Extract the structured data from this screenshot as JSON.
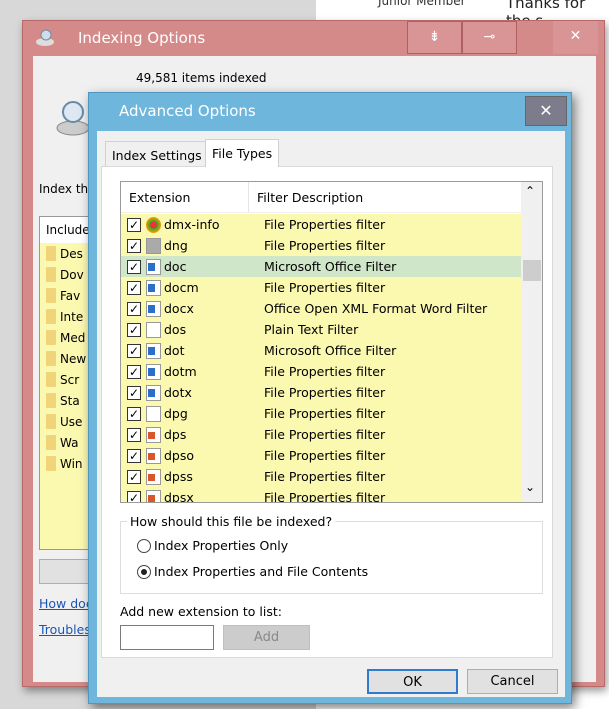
{
  "background_page": {
    "text_1": "Junior Member",
    "text_2": "Thanks for the s"
  },
  "indexing_window": {
    "title": "Indexing Options",
    "items_indexed": "49,581 items indexed",
    "index_label": "Index the",
    "included_header": "Include",
    "included_items": [
      {
        "label": "Des",
        "icon": "desktop-folder-icon"
      },
      {
        "label": "Dov",
        "icon": "download-icon"
      },
      {
        "label": "Fav",
        "icon": "favorites-folder-icon"
      },
      {
        "label": "Inte",
        "icon": "internet-explorer-icon"
      },
      {
        "label": "Med",
        "icon": "drive-icon"
      },
      {
        "label": "New",
        "icon": "folder-icon"
      },
      {
        "label": "Scr",
        "icon": "folder-icon"
      },
      {
        "label": "Sta",
        "icon": "folder-icon"
      },
      {
        "label": "Use",
        "icon": "folder-icon"
      },
      {
        "label": "Wa",
        "icon": "folder-icon"
      },
      {
        "label": "Win",
        "icon": "folder-icon"
      }
    ],
    "link_1": "How doe",
    "link_2": "Troubles"
  },
  "advanced_dialog": {
    "title": "Advanced Options",
    "close": "✕",
    "tabs": [
      {
        "label": "Index Settings",
        "active": false
      },
      {
        "label": "File Types",
        "active": true
      }
    ],
    "columns": {
      "extension": "Extension",
      "description": "Filter Description"
    },
    "rows": [
      {
        "ext": "dmx-info",
        "desc": "File Properties filter",
        "icon": "gear",
        "checked": true
      },
      {
        "ext": "dng",
        "desc": "File Properties filter",
        "icon": "img",
        "checked": true
      },
      {
        "ext": "doc",
        "desc": "Microsoft Office Filter",
        "icon": "word",
        "checked": true,
        "selected": true
      },
      {
        "ext": "docm",
        "desc": "File Properties filter",
        "icon": "word",
        "checked": true
      },
      {
        "ext": "docx",
        "desc": "Office Open XML Format Word Filter",
        "icon": "word",
        "checked": true
      },
      {
        "ext": "dos",
        "desc": "Plain Text Filter",
        "icon": "plain",
        "checked": true
      },
      {
        "ext": "dot",
        "desc": "Microsoft Office Filter",
        "icon": "word",
        "checked": true
      },
      {
        "ext": "dotm",
        "desc": "File Properties filter",
        "icon": "word",
        "checked": true
      },
      {
        "ext": "dotx",
        "desc": "File Properties filter",
        "icon": "word",
        "checked": true
      },
      {
        "ext": "dpg",
        "desc": "File Properties filter",
        "icon": "plain",
        "checked": true
      },
      {
        "ext": "dps",
        "desc": "File Properties filter",
        "icon": "ppt",
        "checked": true
      },
      {
        "ext": "dpso",
        "desc": "File Properties filter",
        "icon": "ppt",
        "checked": true
      },
      {
        "ext": "dpss",
        "desc": "File Properties filter",
        "icon": "ppt",
        "checked": true
      },
      {
        "ext": "dpsx",
        "desc": "File Properties filter",
        "icon": "ppt",
        "checked": true
      }
    ],
    "index_question": "How should this file be indexed?",
    "radio_options": [
      {
        "label": "Index Properties Only",
        "selected": false
      },
      {
        "label": "Index Properties and File Contents",
        "selected": true
      }
    ],
    "add_label": "Add new extension to list:",
    "add_input_value": "",
    "add_button": "Add",
    "ok_button": "OK",
    "cancel_button": "Cancel"
  },
  "colors": {
    "highlight_row": "#cfe6c9",
    "filtered_row": "#fbf8b0",
    "dialog_frame": "#6fb6dc",
    "inactive_frame": "#d58a8a"
  }
}
